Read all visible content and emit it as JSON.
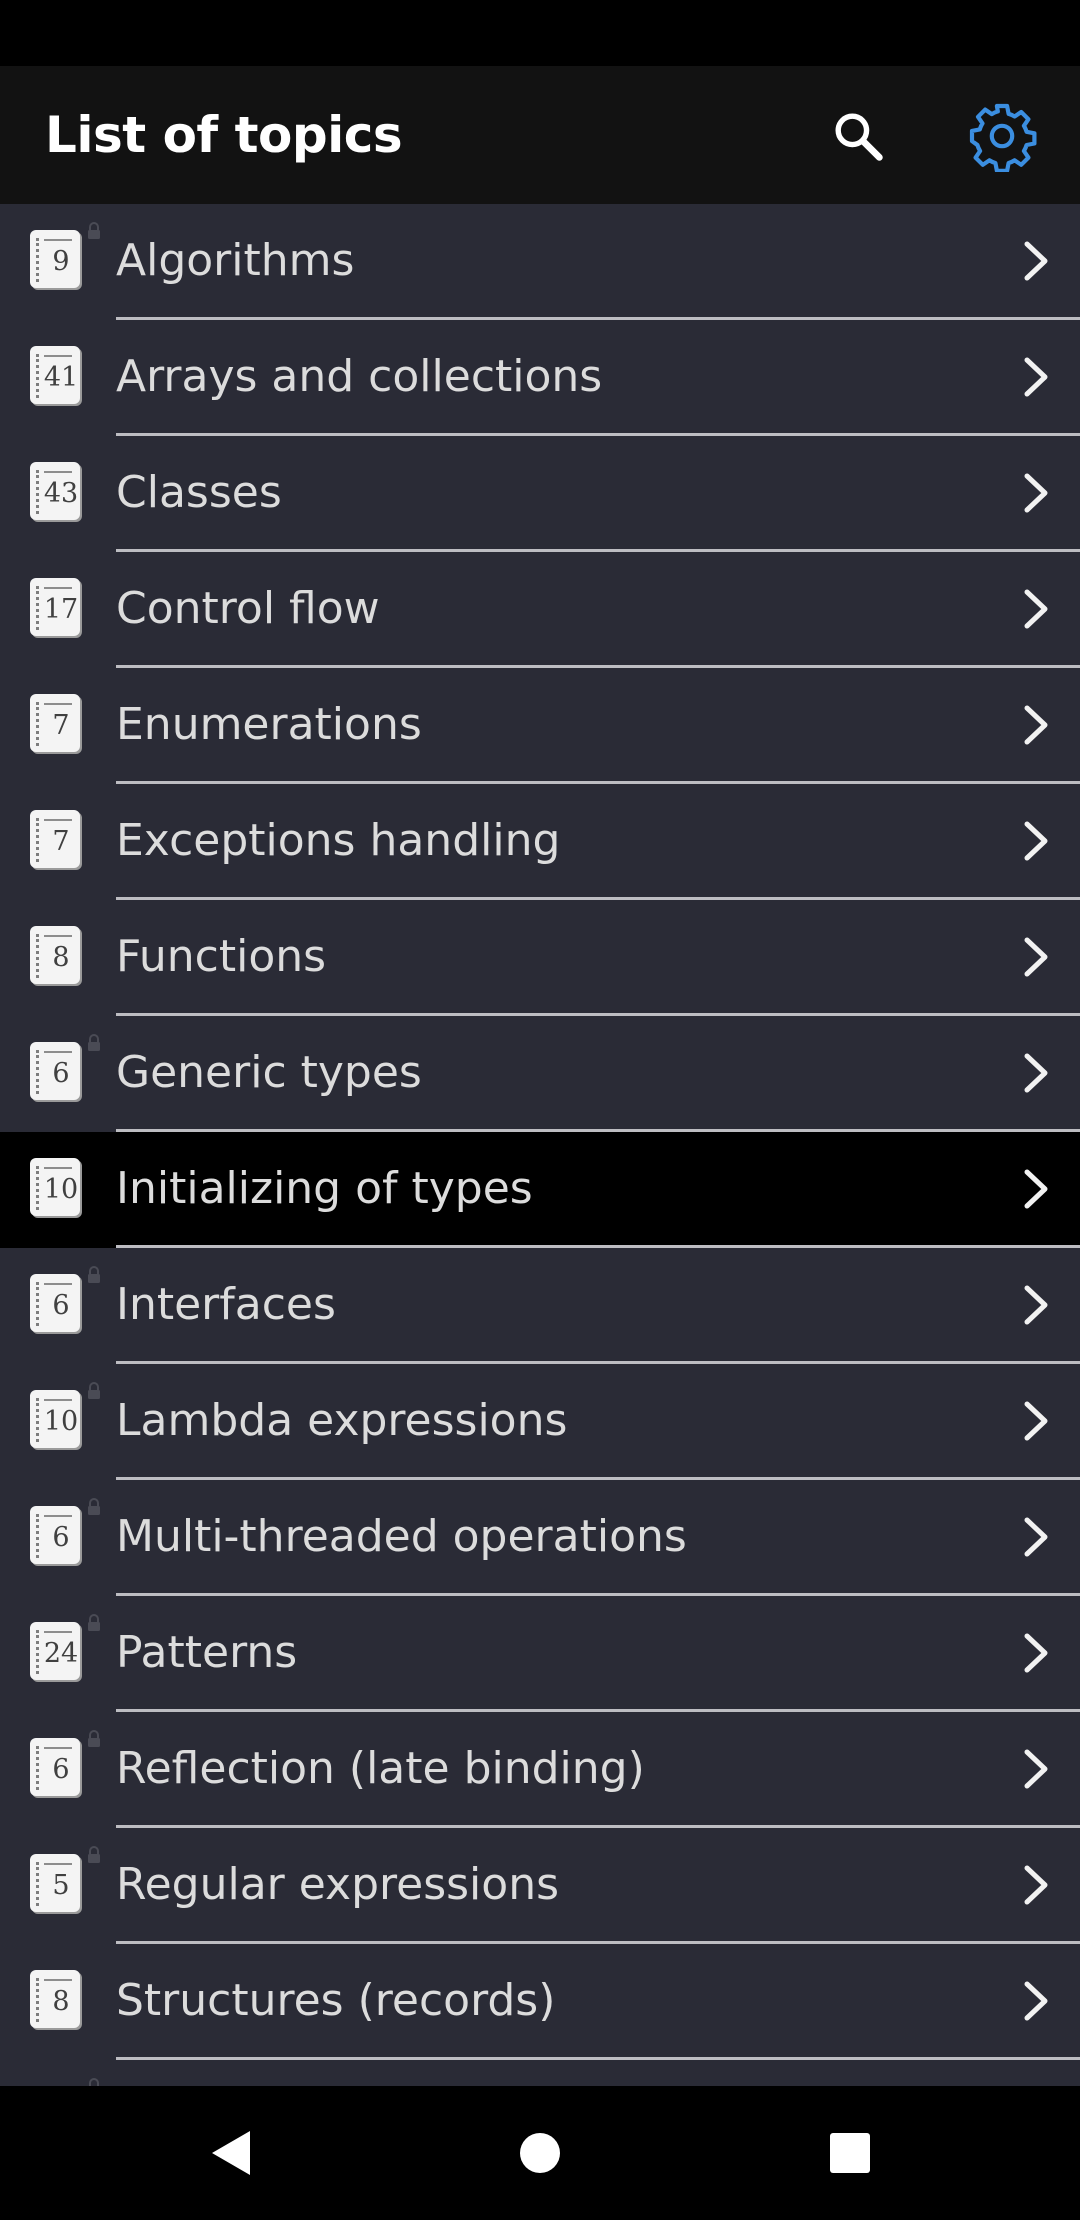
{
  "app_bar": {
    "title": "List of topics",
    "search_icon": "search-icon",
    "settings_icon": "gear-icon",
    "settings_color": "#3b8ee0"
  },
  "topics": [
    {
      "label": "Algorithms",
      "count": "9",
      "locked": true,
      "highlighted": false
    },
    {
      "label": "Arrays and collections",
      "count": "41",
      "locked": false,
      "highlighted": false
    },
    {
      "label": "Classes",
      "count": "43",
      "locked": false,
      "highlighted": false
    },
    {
      "label": "Control flow",
      "count": "17",
      "locked": false,
      "highlighted": false
    },
    {
      "label": "Enumerations",
      "count": "7",
      "locked": false,
      "highlighted": false
    },
    {
      "label": "Exceptions handling",
      "count": "7",
      "locked": false,
      "highlighted": false
    },
    {
      "label": "Functions",
      "count": "8",
      "locked": false,
      "highlighted": false
    },
    {
      "label": "Generic types",
      "count": "6",
      "locked": true,
      "highlighted": false
    },
    {
      "label": "Initializing of types",
      "count": "10",
      "locked": false,
      "highlighted": true
    },
    {
      "label": "Interfaces",
      "count": "6",
      "locked": true,
      "highlighted": false
    },
    {
      "label": "Lambda expressions",
      "count": "10",
      "locked": true,
      "highlighted": false
    },
    {
      "label": "Multi-threaded operations",
      "count": "6",
      "locked": true,
      "highlighted": false
    },
    {
      "label": "Patterns",
      "count": "24",
      "locked": true,
      "highlighted": false
    },
    {
      "label": "Reflection (late binding)",
      "count": "6",
      "locked": true,
      "highlighted": false
    },
    {
      "label": "Regular expressions",
      "count": "5",
      "locked": true,
      "highlighted": false
    },
    {
      "label": "Structures (records)",
      "count": "8",
      "locked": false,
      "highlighted": false
    },
    {
      "label": "",
      "count": "",
      "locked": true,
      "highlighted": false
    }
  ],
  "nav_bar": {
    "back_icon": "triangle-back-icon",
    "home_icon": "circle-home-icon",
    "recents_icon": "square-recents-icon"
  }
}
